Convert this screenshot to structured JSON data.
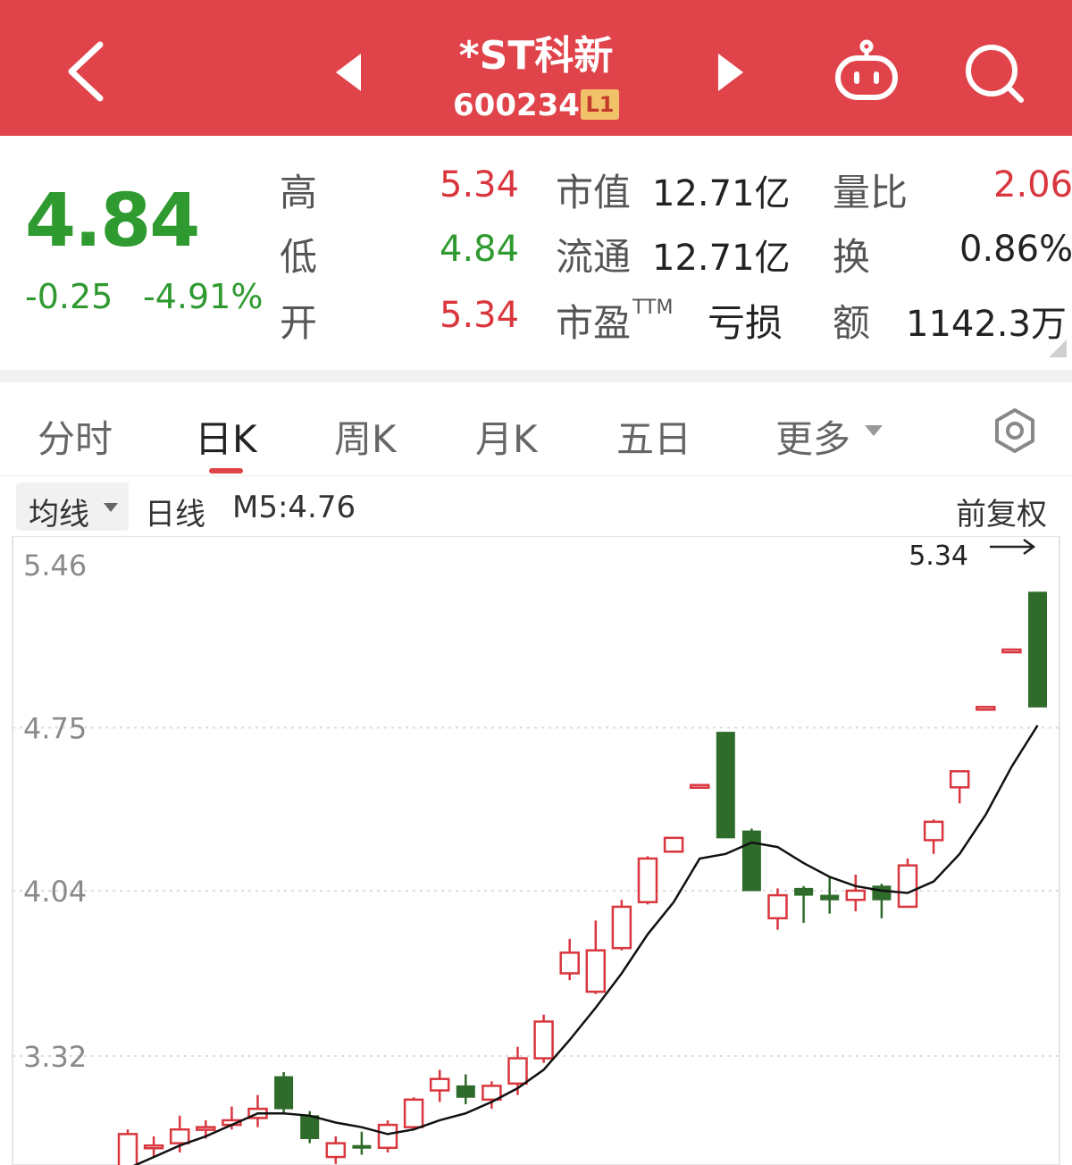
{
  "header": {
    "name": "*ST科新",
    "code": "600234",
    "level_badge": "L1"
  },
  "quote": {
    "price": "4.84",
    "change": "-0.25",
    "change_pct": "-4.91%",
    "high_label": "高",
    "high": "5.34",
    "low_label": "低",
    "low": "4.84",
    "open_label": "开",
    "open": "5.34",
    "mktcap_label": "市值",
    "mktcap": "12.71亿",
    "float_label": "流通",
    "float": "12.71亿",
    "pe_label": "市盈",
    "pe_sup": "TTM",
    "pe": "亏损",
    "vol_ratio_label": "量比",
    "vol_ratio": "2.06",
    "turnover_label": "换",
    "turnover": "0.86%",
    "amount_label": "额",
    "amount": "1142.3万"
  },
  "tabs": [
    {
      "label": "分时",
      "active": false
    },
    {
      "label": "日K",
      "active": true
    },
    {
      "label": "周K",
      "active": false
    },
    {
      "label": "月K",
      "active": false
    },
    {
      "label": "五日",
      "active": false
    },
    {
      "label": "更多",
      "active": false
    }
  ],
  "subbar": {
    "ma_button": "均线",
    "period": "日线",
    "ma_value": "M5:4.76",
    "adjust": "前复权"
  },
  "colors": {
    "header_bg": "#e0444a",
    "up": "#d9363e",
    "down": "#2f6b2a",
    "down_text": "#2f9a2f"
  },
  "chart_data": {
    "type": "candlestick",
    "y_ticks": [
      "5.46",
      "4.75",
      "4.04",
      "3.32"
    ],
    "ylim": [
      2.9,
      5.55
    ],
    "max_label": "5.34",
    "candles": [
      {
        "o": 2.82,
        "c": 2.98,
        "h": 3.0,
        "l": 2.8
      },
      {
        "o": 2.92,
        "c": 2.93,
        "h": 2.97,
        "l": 2.88
      },
      {
        "o": 2.94,
        "c": 3.0,
        "h": 3.06,
        "l": 2.9
      },
      {
        "o": 3.0,
        "c": 3.01,
        "h": 3.04,
        "l": 2.96
      },
      {
        "o": 3.02,
        "c": 3.04,
        "h": 3.1,
        "l": 3.0
      },
      {
        "o": 3.05,
        "c": 3.09,
        "h": 3.15,
        "l": 3.01
      },
      {
        "o": 3.23,
        "c": 3.09,
        "h": 3.25,
        "l": 3.07
      },
      {
        "o": 3.06,
        "c": 2.96,
        "h": 3.08,
        "l": 2.94
      },
      {
        "o": 2.88,
        "c": 2.94,
        "h": 2.97,
        "l": 2.85
      },
      {
        "o": 2.93,
        "c": 2.92,
        "h": 2.99,
        "l": 2.89
      },
      {
        "o": 2.92,
        "c": 3.02,
        "h": 3.04,
        "l": 2.9
      },
      {
        "o": 3.01,
        "c": 3.13,
        "h": 3.14,
        "l": 3.0
      },
      {
        "o": 3.17,
        "c": 3.22,
        "h": 3.26,
        "l": 3.12
      },
      {
        "o": 3.19,
        "c": 3.14,
        "h": 3.24,
        "l": 3.11
      },
      {
        "o": 3.13,
        "c": 3.19,
        "h": 3.21,
        "l": 3.09
      },
      {
        "o": 3.2,
        "c": 3.31,
        "h": 3.36,
        "l": 3.15
      },
      {
        "o": 3.31,
        "c": 3.47,
        "h": 3.5,
        "l": 3.29
      },
      {
        "o": 3.68,
        "c": 3.77,
        "h": 3.83,
        "l": 3.65
      },
      {
        "o": 3.6,
        "c": 3.78,
        "h": 3.91,
        "l": 3.59
      },
      {
        "o": 3.79,
        "c": 3.97,
        "h": 4.0,
        "l": 3.78
      },
      {
        "o": 3.99,
        "c": 4.18,
        "h": 4.19,
        "l": 3.98
      },
      {
        "o": 4.21,
        "c": 4.27,
        "h": 4.27,
        "l": 4.21
      },
      {
        "o": 4.5,
        "c": 4.5,
        "h": 4.5,
        "l": 4.5
      },
      {
        "o": 4.73,
        "c": 4.27,
        "h": 4.73,
        "l": 4.27
      },
      {
        "o": 4.3,
        "c": 4.04,
        "h": 4.31,
        "l": 4.04
      },
      {
        "o": 3.92,
        "c": 4.02,
        "h": 4.05,
        "l": 3.87
      },
      {
        "o": 4.05,
        "c": 4.02,
        "h": 4.06,
        "l": 3.9
      },
      {
        "o": 4.02,
        "c": 4.0,
        "h": 4.1,
        "l": 3.94
      },
      {
        "o": 4.0,
        "c": 4.04,
        "h": 4.11,
        "l": 3.95
      },
      {
        "o": 4.06,
        "c": 4.0,
        "h": 4.07,
        "l": 3.92
      },
      {
        "o": 3.97,
        "c": 4.15,
        "h": 4.18,
        "l": 3.97
      },
      {
        "o": 4.26,
        "c": 4.34,
        "h": 4.35,
        "l": 4.2
      },
      {
        "o": 4.49,
        "c": 4.56,
        "h": 4.56,
        "l": 4.42
      },
      {
        "o": 4.84,
        "c": 4.84,
        "h": 4.84,
        "l": 4.84
      },
      {
        "o": 5.09,
        "c": 5.09,
        "h": 5.09,
        "l": 5.09
      },
      {
        "o": 5.34,
        "c": 4.84,
        "h": 5.34,
        "l": 4.84
      }
    ],
    "ma5": [
      2.83,
      2.88,
      2.93,
      2.97,
      3.02,
      3.07,
      3.07,
      3.06,
      3.03,
      3.01,
      2.98,
      3.0,
      3.04,
      3.07,
      3.12,
      3.18,
      3.26,
      3.39,
      3.53,
      3.68,
      3.85,
      3.99,
      4.18,
      4.2,
      4.25,
      4.23,
      4.16,
      4.1,
      4.06,
      4.04,
      4.03,
      4.08,
      4.2,
      4.37,
      4.58,
      4.76
    ]
  }
}
